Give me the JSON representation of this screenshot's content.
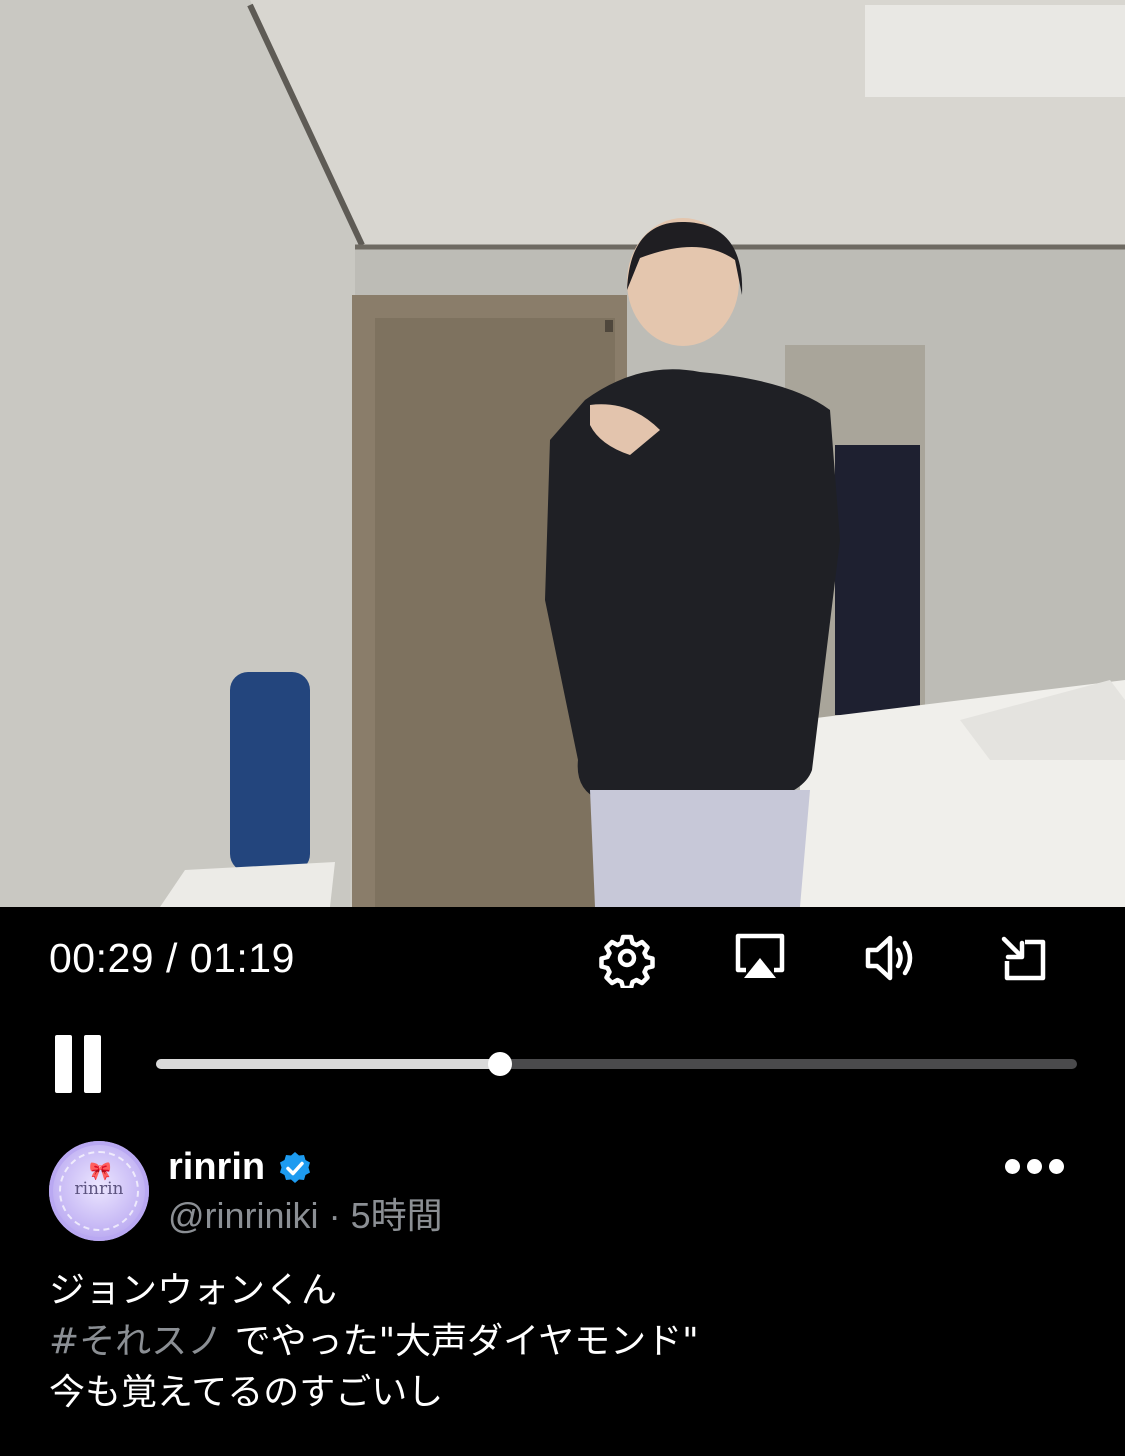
{
  "player": {
    "current_time": "00:29",
    "duration": "01:19",
    "time_separator": " / ",
    "progress": 0.373
  },
  "controls": {
    "icons": [
      "gear-icon",
      "airplay-icon",
      "volume-icon",
      "exit-fullscreen-icon",
      "pause-icon"
    ]
  },
  "post": {
    "avatar_text": "rinrin",
    "display_name": "rinrin",
    "handle": "@rinriniki",
    "separator": " · ",
    "time_ago": "5時間",
    "caption_line1": "ジョンウォンくん",
    "hashtag": "#それスノ",
    "caption_line2_rest": " でやった\"大声ダイヤモンド\"",
    "caption_line3": "今も覚えてるのすごいし"
  },
  "colors": {
    "background": "#000000",
    "muted_text": "#8b8f94",
    "verified_blue": "#1d9bf0",
    "track_bg": "#4a4a4c",
    "track_fill": "#d9d9d9"
  }
}
